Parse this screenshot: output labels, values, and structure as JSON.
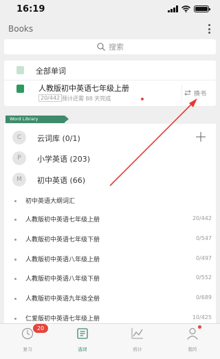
{
  "status_bar": {
    "time": "16:19"
  },
  "header": {
    "title": "Books"
  },
  "search": {
    "placeholder": "搜索"
  },
  "book_card": {
    "all_words_label": "全部单词",
    "current_book_title": "人教版初中英语七年级上册",
    "progress_text": "20/442",
    "estimate_text": "预计还需 88 天完成",
    "switch_label": "换书"
  },
  "library": {
    "tag_label": "Word Library",
    "items": [
      {
        "letter": "C",
        "label": "云词库 (0/1)"
      },
      {
        "letter": "P",
        "label": "小学英语 (203)"
      },
      {
        "letter": "M",
        "label": "初中英语 (66)"
      }
    ]
  },
  "vocab_list": [
    {
      "title": "初中英语大纲词汇",
      "count": ""
    },
    {
      "title": "人教版初中英语七年级上册",
      "count": "20/442"
    },
    {
      "title": "人教版初中英语七年级下册",
      "count": "0/547"
    },
    {
      "title": "人教版初中英语八年级上册",
      "count": "0/497"
    },
    {
      "title": "人教版初中英语八年级下册",
      "count": "0/552"
    },
    {
      "title": "人教版初中英语九年级全册",
      "count": "0/689"
    },
    {
      "title": "仁爱版初中英语七年级上册",
      "count": "10/425"
    }
  ],
  "tab_bar": {
    "tabs": [
      {
        "label": "复习",
        "icon": "review-clock-icon"
      },
      {
        "label": "选词",
        "icon": "books-icon"
      },
      {
        "label": "统计",
        "icon": "chart-icon"
      },
      {
        "label": "我的",
        "icon": "profile-icon"
      }
    ],
    "review_badge": "20",
    "active_index": 1
  },
  "colors": {
    "accent_green": "#3d8b6a",
    "badge_red": "#e5453b",
    "annotation_red": "#e8392f",
    "background": "#efefef"
  }
}
